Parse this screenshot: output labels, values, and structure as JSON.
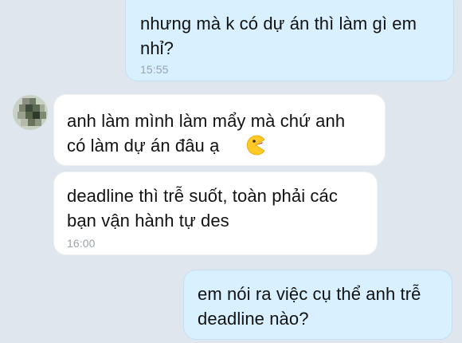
{
  "messages": [
    {
      "text": "nhưng mà k có dự án thì làm gì em\nnhỉ?",
      "time": "15:55"
    },
    {
      "text": "anh làm mình làm mẩy mà chứ anh\ncó làm dự án đâu ạ",
      "emoji": "grinning-pacman-emoji"
    },
    {
      "text": "deadline thì trễ suốt, toàn phải các\nbạn vận hành tự des",
      "time": "16:00"
    },
    {
      "text": "em nói ra việc cụ thể anh trễ\ndeadline nào?"
    }
  ],
  "colors": {
    "background": "#dfe6ee",
    "outgoing_bubble": "#d8f0ff",
    "incoming_bubble": "#ffffff",
    "timestamp": "#9aa3ab"
  }
}
